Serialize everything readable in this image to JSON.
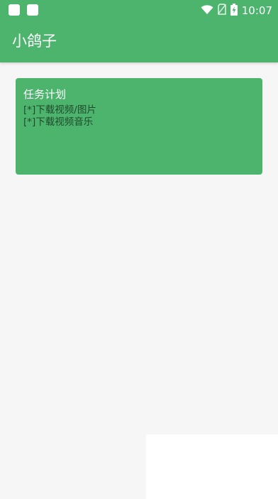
{
  "status_bar": {
    "time": "10:07",
    "icons": [
      "notification-square-icon",
      "notification-square-icon",
      "wifi-icon",
      "no-sim-icon",
      "battery-charging-icon"
    ]
  },
  "app_bar": {
    "title": "小鸽子"
  },
  "task_card": {
    "title": "任务计划",
    "items": [
      {
        "label": "[*]下载视频/图片"
      },
      {
        "label": "[*]下载视频音乐"
      }
    ]
  },
  "colors": {
    "primary": "#4db46e",
    "background": "#f6f6f6",
    "task_text": "#1f4a2c"
  }
}
